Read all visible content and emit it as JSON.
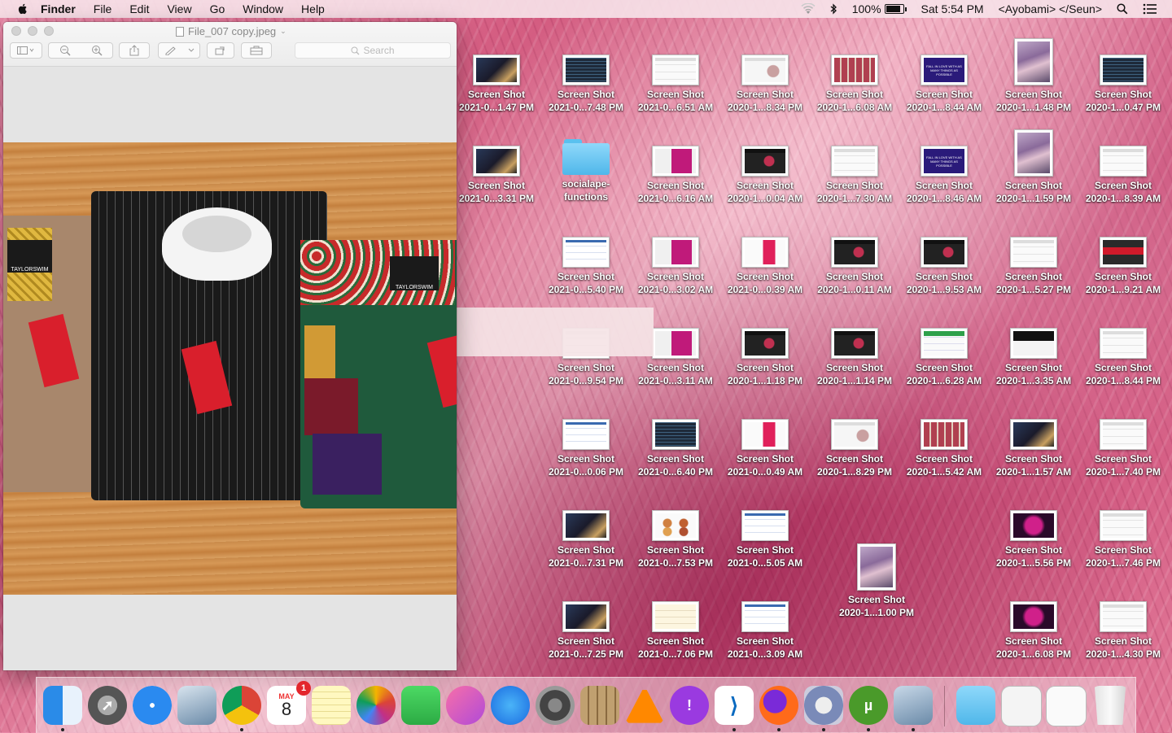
{
  "menubar": {
    "app_name": "Finder",
    "items": [
      "File",
      "Edit",
      "View",
      "Go",
      "Window",
      "Help"
    ],
    "battery": "100%",
    "battery_level": 1.0,
    "clock": "Sat 5:54 PM",
    "user": "<Ayobami> </Seun>"
  },
  "preview_window": {
    "title": "File_007 copy.jpeg",
    "search_placeholder": "Search",
    "brand_text": "TAYLORSWIM"
  },
  "desktop_icons": [
    {
      "line1": "Screen Shot",
      "line2": "2021-0...1.47 PM",
      "thumb": "dark-photo"
    },
    {
      "line1": "Screen Shot",
      "line2": "2021-0...7.48 PM",
      "thumb": "code"
    },
    {
      "line1": "Screen Shot",
      "line2": "2021-0...6.51 AM",
      "thumb": "white"
    },
    {
      "line1": "Screen Shot",
      "line2": "2020-1...8.34 PM",
      "thumb": "white-img"
    },
    {
      "line1": "Screen Shot",
      "line2": "2020-1...6.08 AM",
      "thumb": "grid"
    },
    {
      "line1": "Screen Shot",
      "line2": "2020-1...8.44 AM",
      "thumb": "purple-text",
      "caption": "FALL IN LOVE WITH AS MANY THINGS AS POSSIBLE"
    },
    {
      "line1": "Screen Shot",
      "line2": "2020-1...1.48 PM",
      "thumb": "photo-portrait"
    },
    {
      "line1": "Screen Shot",
      "line2": "2020-1...0.47 PM",
      "thumb": "code"
    },
    {
      "line1": "Screen Shot",
      "line2": "2021-0...3.31 PM",
      "thumb": "dark-photo"
    },
    {
      "line1": "socialape-",
      "line2": "functions",
      "thumb": "folder"
    },
    {
      "line1": "Screen Shot",
      "line2": "2021-0...6.16 AM",
      "thumb": "magenta"
    },
    {
      "line1": "Screen Shot",
      "line2": "2020-1...0.04 AM",
      "thumb": "dark-web"
    },
    {
      "line1": "Screen Shot",
      "line2": "2020-1...7.30 AM",
      "thumb": "white"
    },
    {
      "line1": "Screen Shot",
      "line2": "2020-1...8.46 AM",
      "thumb": "purple-text",
      "caption": "FALL IN LOVE WITH AS MANY THINGS AS POSSIBLE"
    },
    {
      "line1": "Screen Shot",
      "line2": "2020-1...1.59 PM",
      "thumb": "photo-portrait"
    },
    {
      "line1": "Screen Shot",
      "line2": "2020-1...8.39 AM",
      "thumb": "white"
    },
    {
      "line1": "Screen Shot",
      "line2": "2021-0...5.40 PM",
      "thumb": "white-blue"
    },
    {
      "line1": "Screen Shot",
      "line2": "2021-0...3.02 AM",
      "thumb": "magenta"
    },
    {
      "line1": "Screen Shot",
      "line2": "2021-0...0.39 AM",
      "thumb": "pink-card"
    },
    {
      "line1": "Screen Shot",
      "line2": "2020-1...0.11 AM",
      "thumb": "dark-web"
    },
    {
      "line1": "Screen Shot",
      "line2": "2020-1...9.53 AM",
      "thumb": "dark-web"
    },
    {
      "line1": "Screen Shot",
      "line2": "2020-1...5.27 PM",
      "thumb": "white"
    },
    {
      "line1": "Screen Shot",
      "line2": "2020-1...9.21 AM",
      "thumb": "red-web"
    },
    {
      "line1": "Screen Shot",
      "line2": "2021-0...9.54 PM",
      "thumb": "white"
    },
    {
      "line1": "Screen Shot",
      "line2": "2021-0...3.11 AM",
      "thumb": "magenta"
    },
    {
      "line1": "Screen Shot",
      "line2": "2020-1...1.18 PM",
      "thumb": "dark-web"
    },
    {
      "line1": "Screen Shot",
      "line2": "2020-1...1.14 PM",
      "thumb": "dark-web"
    },
    {
      "line1": "Screen Shot",
      "line2": "2020-1...6.28 AM",
      "thumb": "green-web"
    },
    {
      "line1": "Screen Shot",
      "line2": "2020-1...3.35 AM",
      "thumb": "black-web"
    },
    {
      "line1": "Screen Shot",
      "line2": "2020-1...8.44 PM",
      "thumb": "white"
    },
    {
      "line1": "Screen Shot",
      "line2": "2021-0...0.06 PM",
      "thumb": "white-blue"
    },
    {
      "line1": "Screen Shot",
      "line2": "2021-0...6.40 PM",
      "thumb": "code"
    },
    {
      "line1": "Screen Shot",
      "line2": "2021-0...0.49 AM",
      "thumb": "pink-card"
    },
    {
      "line1": "Screen Shot",
      "line2": "2020-1...8.29 PM",
      "thumb": "white-img"
    },
    {
      "line1": "Screen Shot",
      "line2": "2020-1...5.42 AM",
      "thumb": "grid"
    },
    {
      "line1": "Screen Shot",
      "line2": "2020-1...1.57 AM",
      "thumb": "dark-photo"
    },
    {
      "line1": "Screen Shot",
      "line2": "2020-1...7.40 PM",
      "thumb": "white"
    },
    {
      "line1": "Screen Shot",
      "line2": "2021-0...7.31 PM",
      "thumb": "dark-photo"
    },
    {
      "line1": "Screen Shot",
      "line2": "2021-0...7.53 PM",
      "thumb": "food"
    },
    {
      "line1": "Screen Shot",
      "line2": "2021-0...5.05 AM",
      "thumb": "white-blue"
    },
    {
      "line1": "Screen Shot",
      "line2": "2020-1...1.00 PM",
      "thumb": "photo-portrait"
    },
    {
      "line1": "Screen Shot",
      "line2": "2020-1...5.56 PM",
      "thumb": "magenta-dark"
    },
    {
      "line1": "Screen Shot",
      "line2": "2020-1...7.46 PM",
      "thumb": "white"
    },
    {
      "line1": "Screen Shot",
      "line2": "2021-0...7.25 PM",
      "thumb": "dark-photo"
    },
    {
      "line1": "Screen Shot",
      "line2": "2021-0...7.06 PM",
      "thumb": "cream"
    },
    {
      "line1": "Screen Shot",
      "line2": "2021-0...3.09 AM",
      "thumb": "white-blue"
    },
    {
      "line1": "Screen Shot",
      "line2": "2020-1...6.08 PM",
      "thumb": "magenta-dark"
    },
    {
      "line1": "Screen Shot",
      "line2": "2020-1...4.30 PM",
      "thumb": "white"
    }
  ],
  "dock": {
    "apps": [
      {
        "name": "finder-icon",
        "running": true
      },
      {
        "name": "launchpad-icon",
        "running": false
      },
      {
        "name": "safari-icon",
        "running": false
      },
      {
        "name": "mail-icon",
        "running": false
      },
      {
        "name": "chrome-icon",
        "running": true
      },
      {
        "name": "calendar-icon",
        "running": false,
        "month": "MAY",
        "day": "8",
        "badge": "1"
      },
      {
        "name": "notes-icon",
        "running": false
      },
      {
        "name": "photos-icon",
        "running": false
      },
      {
        "name": "facetime-icon",
        "running": false
      },
      {
        "name": "itunes-icon",
        "running": false
      },
      {
        "name": "app-store-icon",
        "running": false
      },
      {
        "name": "system-preferences-icon",
        "running": false
      },
      {
        "name": "calculator-icon",
        "running": false
      },
      {
        "name": "vlc-icon",
        "running": false
      },
      {
        "name": "feedback-icon",
        "running": false
      },
      {
        "name": "vscode-icon",
        "running": true
      },
      {
        "name": "firefox-icon",
        "running": true
      },
      {
        "name": "settings-app-icon",
        "running": true
      },
      {
        "name": "utorrent-icon",
        "running": true
      },
      {
        "name": "preview-icon",
        "running": true
      },
      {
        "name": "downloads-folder-icon",
        "running": false
      },
      {
        "name": "document-stack-icon",
        "running": false
      },
      {
        "name": "screenshot-stack-icon",
        "running": false
      },
      {
        "name": "trash-icon",
        "running": false
      }
    ]
  }
}
